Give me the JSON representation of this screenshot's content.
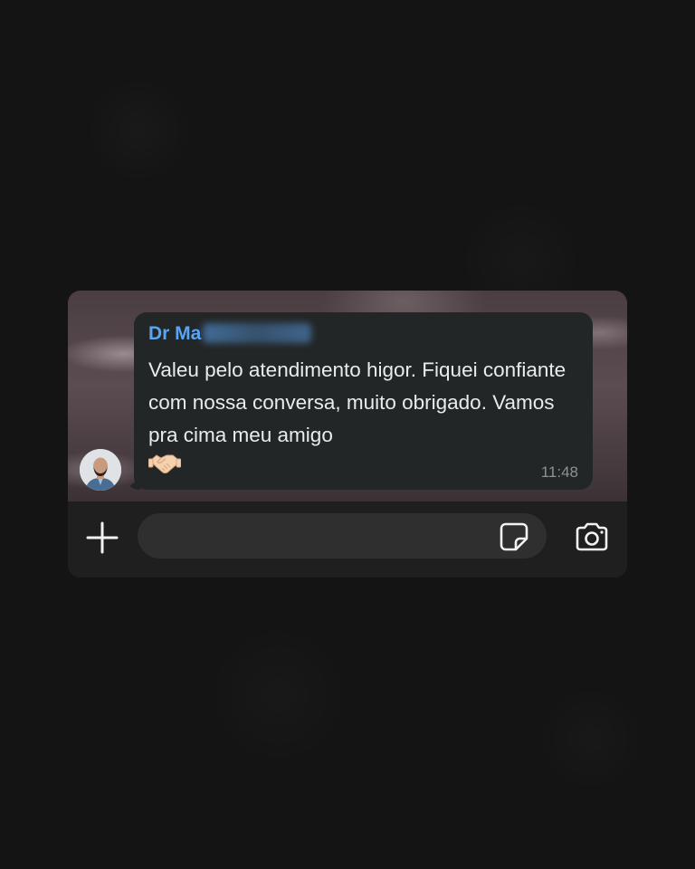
{
  "chat": {
    "message": {
      "sender_prefix": "Dr Ma",
      "text": "Valeu pelo atendimento higor. Fiquei confiante com nossa conversa, muito obrigado. Vamos pra cima meu amigo",
      "emoji": "handshake-emoji",
      "time": "11:48"
    },
    "sender_avatar": "avatar-photo"
  },
  "composer": {
    "plus_icon": "plus-icon",
    "input_value": "",
    "sticker_icon": "sticker-icon",
    "camera_icon": "camera-icon"
  },
  "colors": {
    "sender_name": "#5ba4f2",
    "bubble": "#232626",
    "message_text": "#e9ecee",
    "timestamp": "#8c9194",
    "composer_bar": "#1f1f1f",
    "input_field": "#2f2f2f"
  }
}
